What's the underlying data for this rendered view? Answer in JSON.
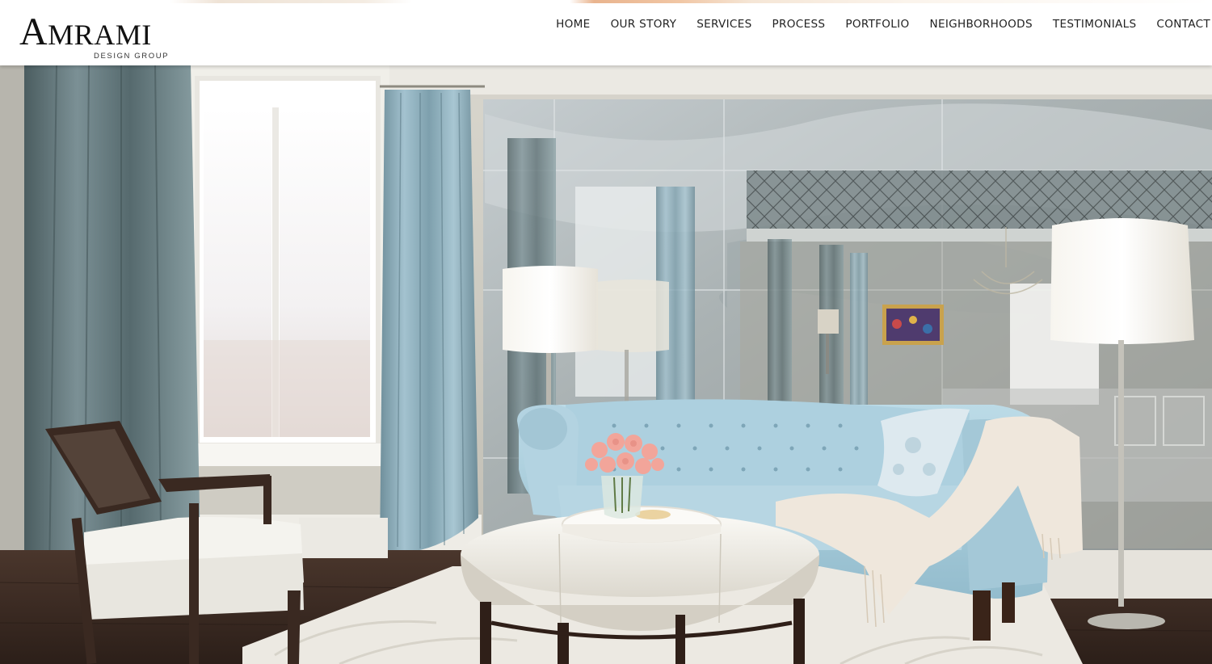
{
  "brand": {
    "name_initial": "A",
    "name_rest": "MRAMI",
    "subtitle": "DESIGN GROUP",
    "text_color": "#111111"
  },
  "nav": {
    "items": [
      {
        "label": "HOME"
      },
      {
        "label": "OUR STORY"
      },
      {
        "label": "SERVICES"
      },
      {
        "label": "PROCESS"
      },
      {
        "label": "PORTFOLIO"
      },
      {
        "label": "NEIGHBORHOODS"
      },
      {
        "label": "TESTIMONIALS"
      },
      {
        "label": "CONTACT"
      }
    ]
  },
  "hero": {
    "image_alt": "Living room with light blue tufted sofa, white oval ottoman, mirrored wall and blue drapes",
    "colors": {
      "sofa": "#a8cbd9",
      "drapes": "#8fb1c0",
      "wall": "#c9c6bb",
      "floor": "#3a2a22",
      "ottoman": "#f3f1ec"
    }
  }
}
